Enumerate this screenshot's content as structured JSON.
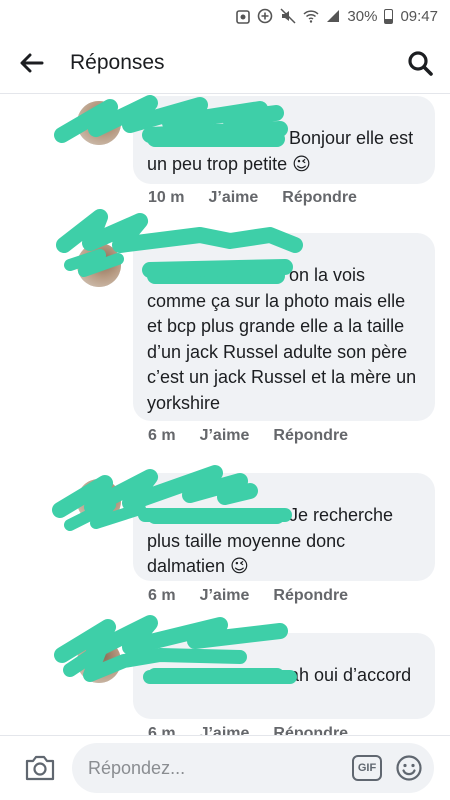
{
  "status_bar": {
    "battery": "30%",
    "time": "09:47"
  },
  "header": {
    "title": "Réponses"
  },
  "comments": [
    {
      "text": "Bonjour elle est un peu trop petite 😉",
      "time": "10 m",
      "like": "J’aime",
      "reply": "Répondre"
    },
    {
      "text": "on la vois comme ça sur la photo mais elle et bcp plus grande elle a la taille d’un jack Russel adulte son père c’est un jack Russel et la mère un yorkshire",
      "time": "6 m",
      "like": "J’aime",
      "reply": "Répondre"
    },
    {
      "text": "Je recherche plus taille moyenne donc dalmatien 😉",
      "time": "6 m",
      "like": "J’aime",
      "reply": "Répondre"
    },
    {
      "text": "ah oui d’accord",
      "time": "6 m",
      "like": "J’aime",
      "reply": "Répondre"
    }
  ],
  "compose": {
    "placeholder": "Répondez...",
    "gif_label": "GIF"
  },
  "colors": {
    "redaction": "#3ecfa8",
    "bubble": "#f0f2f5",
    "meta": "#65676b"
  }
}
